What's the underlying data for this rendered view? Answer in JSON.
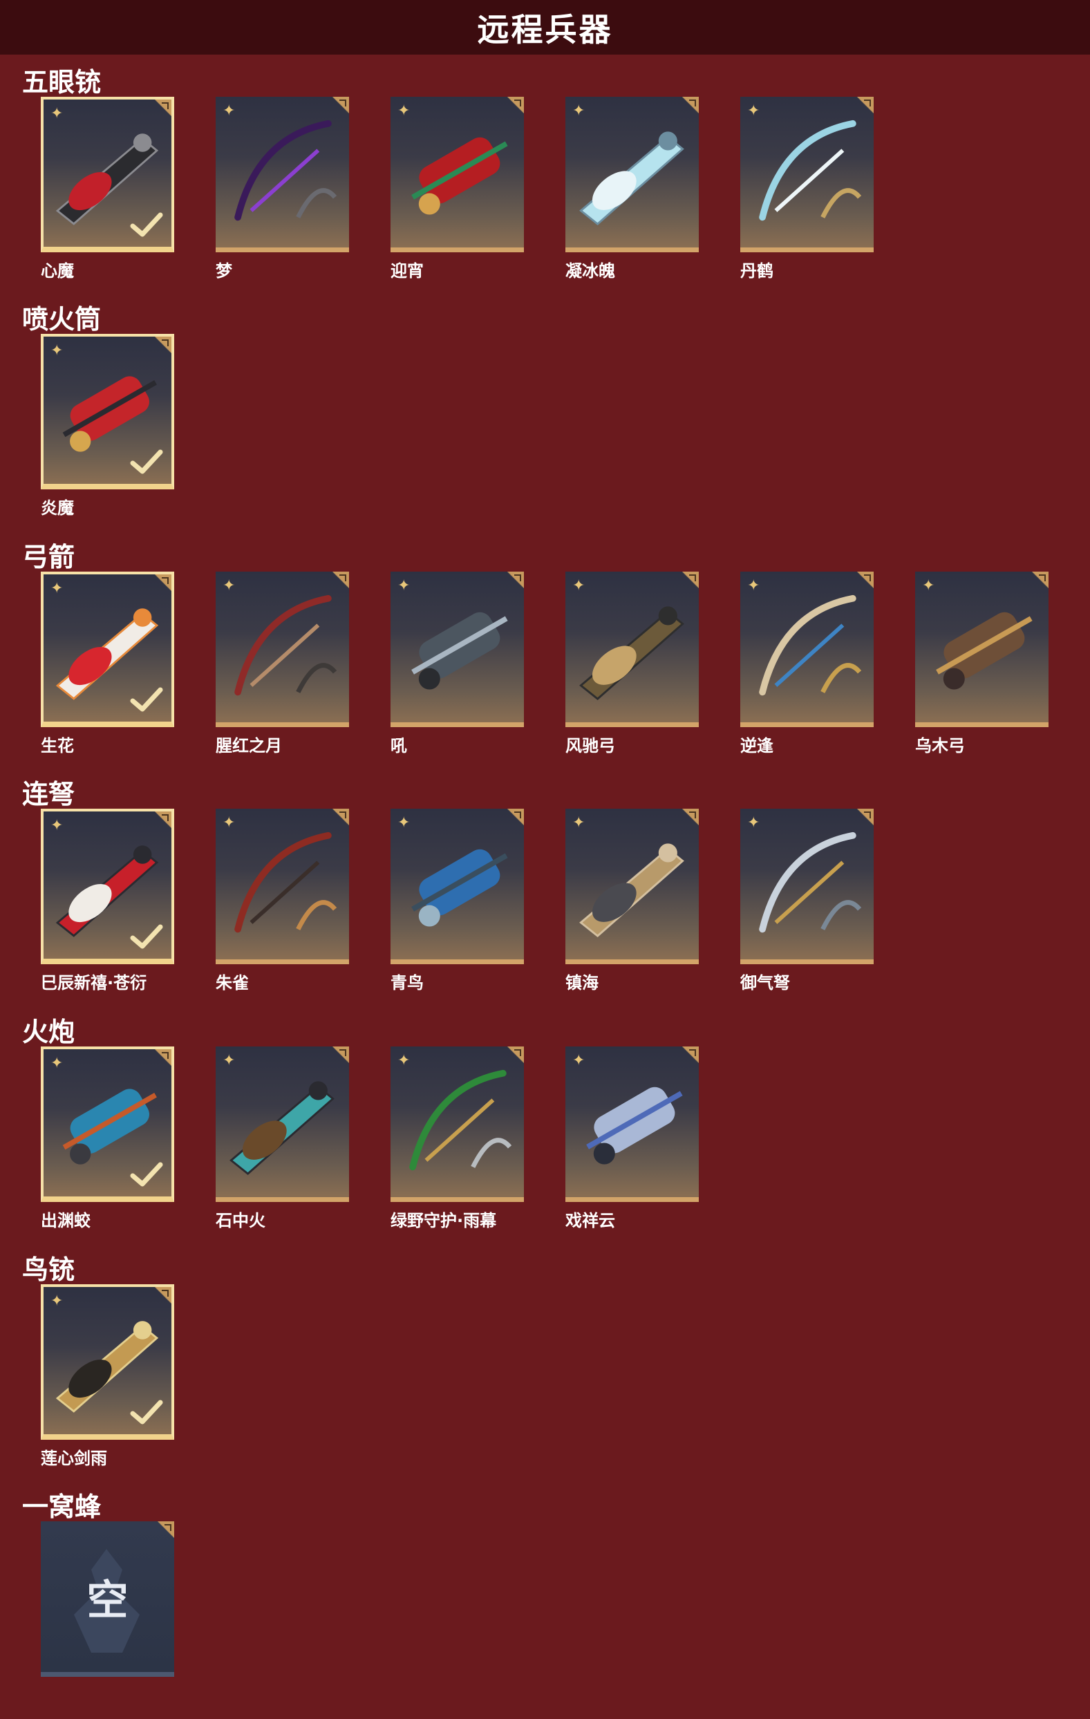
{
  "header": {
    "title": "远程兵器"
  },
  "sections": [
    {
      "title": "五眼铳",
      "items": [
        {
          "name": "心魔",
          "selected": true,
          "palette": [
            "#2b2b2f",
            "#c2202a",
            "#8b8b90"
          ]
        },
        {
          "name": "梦",
          "selected": false,
          "palette": [
            "#3a1a5a",
            "#8b3fd0",
            "#6a6a70"
          ]
        },
        {
          "name": "迎宵",
          "selected": false,
          "palette": [
            "#b51e22",
            "#2a8a55",
            "#d6a34e"
          ]
        },
        {
          "name": "凝冰魄",
          "selected": false,
          "palette": [
            "#b6e3ee",
            "#e8f4f8",
            "#6c8ea0"
          ]
        },
        {
          "name": "丹鹤",
          "selected": false,
          "palette": [
            "#9bd4e4",
            "#eef6f8",
            "#c6a562"
          ]
        }
      ]
    },
    {
      "title": "喷火筒",
      "items": [
        {
          "name": "炎魔",
          "selected": true,
          "palette": [
            "#c4252a",
            "#2a2a30",
            "#d6a64e"
          ]
        }
      ]
    },
    {
      "title": "弓箭",
      "items": [
        {
          "name": "生花",
          "selected": true,
          "palette": [
            "#f1ece6",
            "#d7262e",
            "#e88a3a"
          ]
        },
        {
          "name": "腥红之月",
          "selected": false,
          "palette": [
            "#8f2a28",
            "#b58c6a",
            "#3e3a38"
          ]
        },
        {
          "name": "吼",
          "selected": false,
          "palette": [
            "#4c5660",
            "#a9b6c2",
            "#2a2c30"
          ]
        },
        {
          "name": "风驰弓",
          "selected": false,
          "palette": [
            "#6c5a3a",
            "#c6a46a",
            "#2e2e2e"
          ]
        },
        {
          "name": "逆逢",
          "selected": false,
          "palette": [
            "#d9c7a4",
            "#3e84c4",
            "#c8a04e"
          ]
        },
        {
          "name": "乌木弓",
          "selected": false,
          "palette": [
            "#6e4f38",
            "#c89a54",
            "#3a2c2a"
          ]
        }
      ]
    },
    {
      "title": "连弩",
      "items": [
        {
          "name": "巳辰新禧·苍衍",
          "selected": true,
          "palette": [
            "#c7202a",
            "#f0ece6",
            "#2a2a30"
          ]
        },
        {
          "name": "朱雀",
          "selected": false,
          "palette": [
            "#8e2b22",
            "#3a2e2a",
            "#c48a4a"
          ]
        },
        {
          "name": "青鸟",
          "selected": false,
          "palette": [
            "#2e6eb0",
            "#3a4e5e",
            "#9ab4c4"
          ]
        },
        {
          "name": "镇海",
          "selected": false,
          "palette": [
            "#b89a6a",
            "#4a4a50",
            "#d4c0a0"
          ]
        },
        {
          "name": "御气弩",
          "selected": false,
          "palette": [
            "#c9d2dc",
            "#c8a04e",
            "#7a8896"
          ]
        }
      ]
    },
    {
      "title": "火炮",
      "items": [
        {
          "name": "出渊蛟",
          "selected": true,
          "palette": [
            "#2a86b0",
            "#c65a2a",
            "#3a3a40"
          ]
        },
        {
          "name": "石中火",
          "selected": false,
          "palette": [
            "#3ea6a8",
            "#6a4a2a",
            "#2a2a30"
          ]
        },
        {
          "name": "绿野守护·雨幕",
          "selected": false,
          "palette": [
            "#2e8a3a",
            "#c8a04e",
            "#b8bcc0"
          ]
        },
        {
          "name": "戏祥云",
          "selected": false,
          "palette": [
            "#a9b8d6",
            "#4e6ab8",
            "#2a2e3a"
          ]
        }
      ]
    },
    {
      "title": "鸟铳",
      "items": [
        {
          "name": "莲心剑雨",
          "selected": true,
          "palette": [
            "#c39a52",
            "#2a2622",
            "#e4cf8e"
          ]
        }
      ]
    },
    {
      "title": "一窝蜂",
      "items": [
        {
          "name": "",
          "selected": false,
          "empty": true,
          "empty_glyph": "空"
        }
      ]
    }
  ]
}
